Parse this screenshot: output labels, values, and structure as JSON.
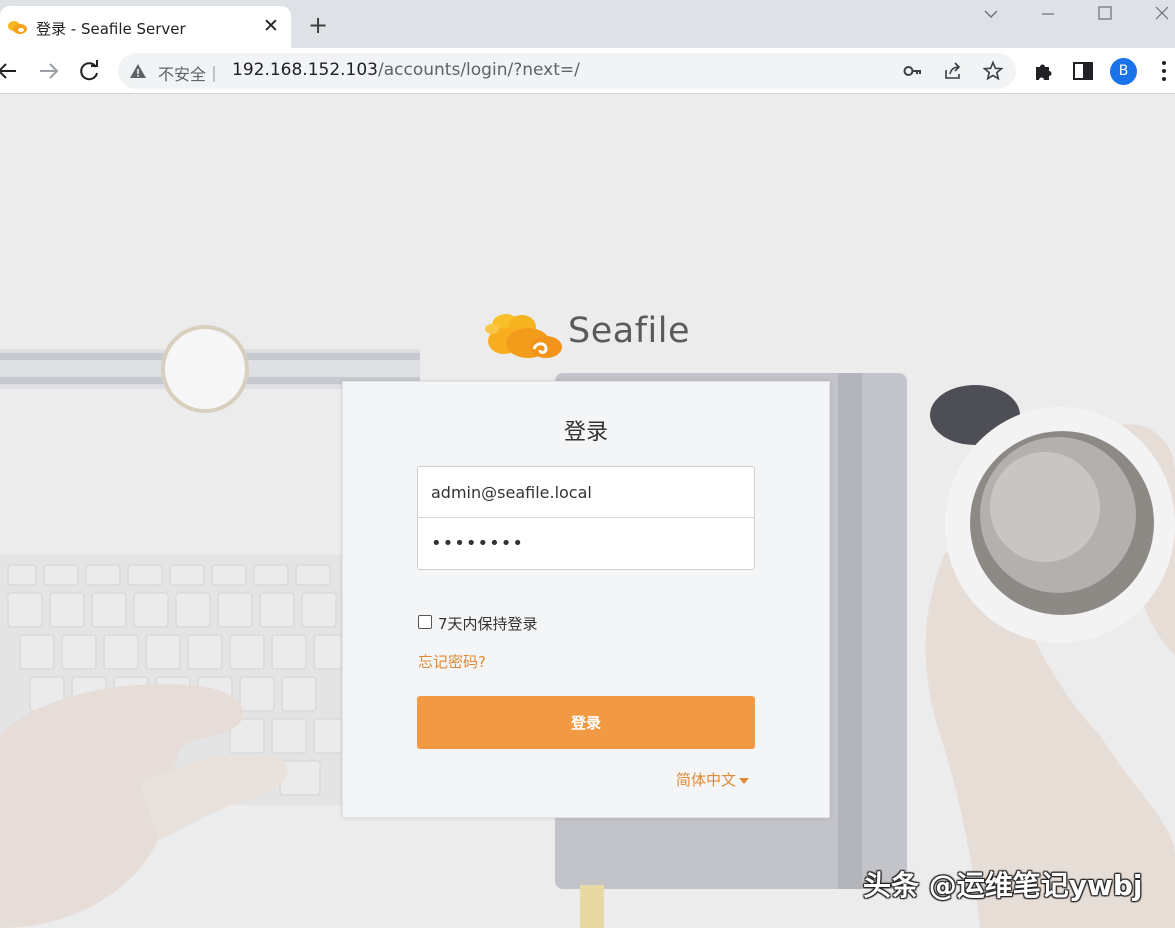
{
  "browser": {
    "tab_title": "登录 - Seafile Server",
    "tab_close": "✕",
    "new_tab": "+",
    "security_label": "不安全｜",
    "url_host": "192.168.152.103",
    "url_path": "/accounts/login/?next=/",
    "profile_initial": "B",
    "profile_color": "#1a73e8"
  },
  "page": {
    "brand_name": "Seafile",
    "login_title": "登录",
    "username_value": "admin@seafile.local",
    "password_value": "••••••••",
    "remember_label": "7天内保持登录",
    "remember_checked": false,
    "forgot_link": "忘记密码?",
    "submit_label": "登录",
    "language": "简体中文",
    "accent_color": "#f19a43",
    "link_color": "#e08a36"
  },
  "watermark": "头条 @运维笔记ywbj"
}
